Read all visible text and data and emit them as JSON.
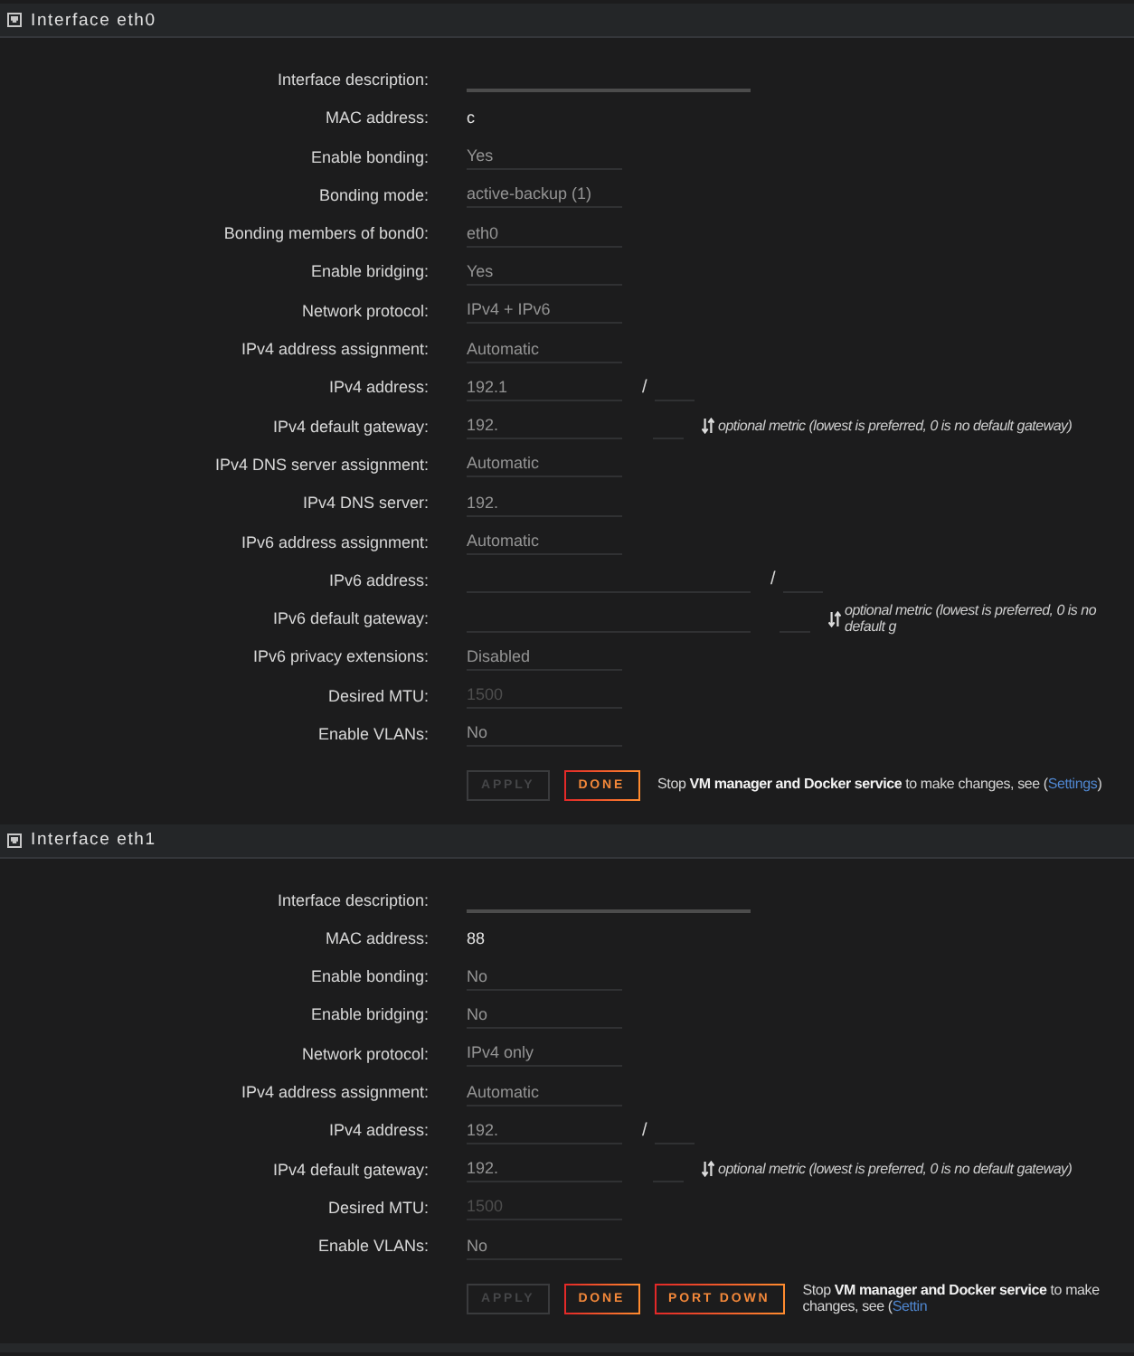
{
  "interfaces": [
    {
      "title": "Interface eth0",
      "rows": [
        {
          "label": "Interface description:",
          "kind": "wideinput",
          "disabled": false
        },
        {
          "label": "MAC address:",
          "kind": "static",
          "value": "c"
        },
        {
          "label": "Enable bonding:",
          "kind": "select",
          "value": "Yes",
          "disabled": true
        },
        {
          "label": "Bonding mode:",
          "kind": "select",
          "value": "active-backup (1)",
          "disabled": true
        },
        {
          "label": "Bonding members of bond0:",
          "kind": "select",
          "value": "eth0",
          "disabled": true
        },
        {
          "label": "Enable bridging:",
          "kind": "select",
          "value": "Yes",
          "disabled": true
        },
        {
          "label": "Network protocol:",
          "kind": "select",
          "value": "IPv4 + IPv6",
          "disabled": true
        },
        {
          "label": "IPv4 address assignment:",
          "kind": "select",
          "value": "Automatic",
          "disabled": true
        },
        {
          "label": "IPv4 address:",
          "kind": "address",
          "value": "192.1",
          "separator": "/",
          "disabled": true
        },
        {
          "label": "IPv4 default gateway:",
          "kind": "gateway",
          "value": "192.",
          "hint": "optional metric (lowest is preferred, 0 is no default gateway)",
          "disabled": true
        },
        {
          "label": "IPv4 DNS server assignment:",
          "kind": "select",
          "value": "Automatic",
          "disabled": true
        },
        {
          "label": "IPv4 DNS server:",
          "kind": "input",
          "value": "192.",
          "disabled": true
        },
        {
          "label": "IPv6 address assignment:",
          "kind": "select",
          "value": "Automatic",
          "disabled": true
        },
        {
          "label": "IPv6 address:",
          "kind": "wideaddress",
          "separator": "/",
          "disabled": true
        },
        {
          "label": "IPv6 default gateway:",
          "kind": "widegateway",
          "hint": "optional metric (lowest is preferred, 0 is no default g",
          "disabled": true
        },
        {
          "label": "IPv6 privacy extensions:",
          "kind": "select",
          "value": "Disabled",
          "disabled": true
        },
        {
          "label": "Desired MTU:",
          "kind": "input",
          "placeholder": "1500",
          "disabled": true
        },
        {
          "label": "Enable VLANs:",
          "kind": "select",
          "value": "No",
          "disabled": true
        }
      ],
      "buttons": [
        {
          "label": "APPLY",
          "disabled": true
        },
        {
          "label": "DONE",
          "disabled": false
        }
      ],
      "note": {
        "text": "Stop **VM manager and Docker service** to make changes, see (",
        "link": "Settings",
        "after": ")"
      }
    },
    {
      "title": "Interface eth1",
      "rows": [
        {
          "label": "Interface description:",
          "kind": "wideinput",
          "disabled": false
        },
        {
          "label": "MAC address:",
          "kind": "static",
          "value": "88"
        },
        {
          "label": "Enable bonding:",
          "kind": "select",
          "value": "No",
          "disabled": true
        },
        {
          "label": "Enable bridging:",
          "kind": "select",
          "value": "No",
          "disabled": true
        },
        {
          "label": "Network protocol:",
          "kind": "select",
          "value": "IPv4 only",
          "disabled": true
        },
        {
          "label": "IPv4 address assignment:",
          "kind": "select",
          "value": "Automatic",
          "disabled": true
        },
        {
          "label": "IPv4 address:",
          "kind": "address",
          "value": "192.",
          "separator": "/",
          "disabled": true
        },
        {
          "label": "IPv4 default gateway:",
          "kind": "gateway",
          "value": "192.",
          "hint": "optional metric (lowest is preferred, 0 is no default gateway)",
          "disabled": true
        },
        {
          "label": "Desired MTU:",
          "kind": "input",
          "placeholder": "1500",
          "disabled": true
        },
        {
          "label": "Enable VLANs:",
          "kind": "select",
          "value": "No",
          "disabled": true
        }
      ],
      "buttons": [
        {
          "label": "APPLY",
          "disabled": true
        },
        {
          "label": "DONE",
          "disabled": false
        },
        {
          "label": "PORT DOWN",
          "disabled": false
        }
      ],
      "note": {
        "text": "Stop **VM manager and Docker service** to make changes, see (",
        "link": "Settin"
      }
    }
  ]
}
